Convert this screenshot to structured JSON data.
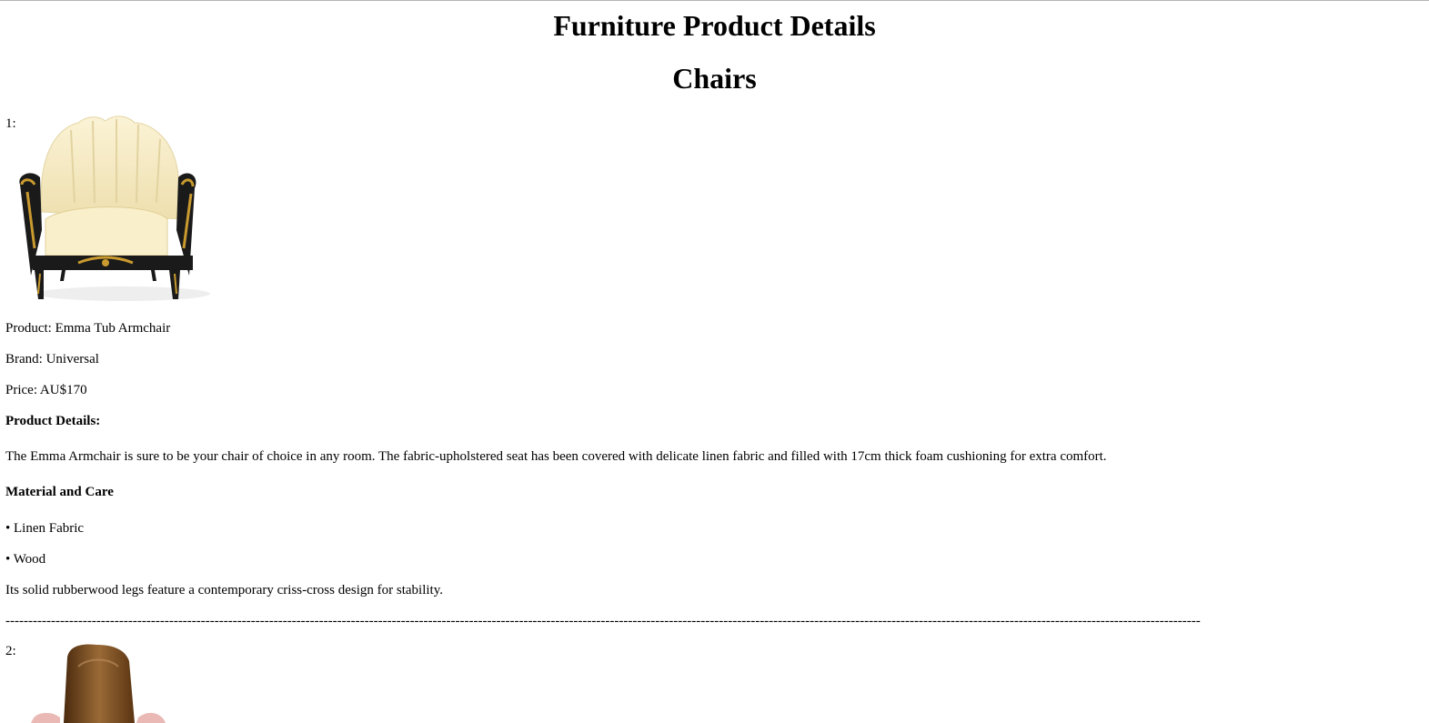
{
  "page": {
    "title": "Furniture Product Details",
    "section": "Chairs"
  },
  "products": [
    {
      "number": "1:",
      "image_icon": "armchair-photo",
      "product_line": "Product: Emma Tub Armchair",
      "brand_line": "Brand: Universal",
      "price_line": "Price: AU$170",
      "details_heading": "Product Details:",
      "description": "The Emma Armchair is sure to be your chair of choice in any room. The fabric-upholstered seat has been covered with delicate linen fabric and filled with 17cm thick foam cushioning for extra comfort.",
      "material_heading": "Material and Care",
      "materials": [
        "• Linen Fabric",
        "• Wood"
      ],
      "note": "Its solid rubberwood legs feature a contemporary criss-cross design for stability."
    },
    {
      "number": "2:",
      "image_icon": "leather-chair-photo"
    }
  ],
  "separator": "------------------------------------------------------------------------------------------------------------------------------------------------------------------------------------------------------------------------------------------------------------------------------------------------",
  "colors": {
    "cream_upholstery": "#f7edc4",
    "frame_black": "#1a1a1a",
    "gold_trim": "#c99a2e",
    "leather_brown": "#7a4a1e"
  }
}
